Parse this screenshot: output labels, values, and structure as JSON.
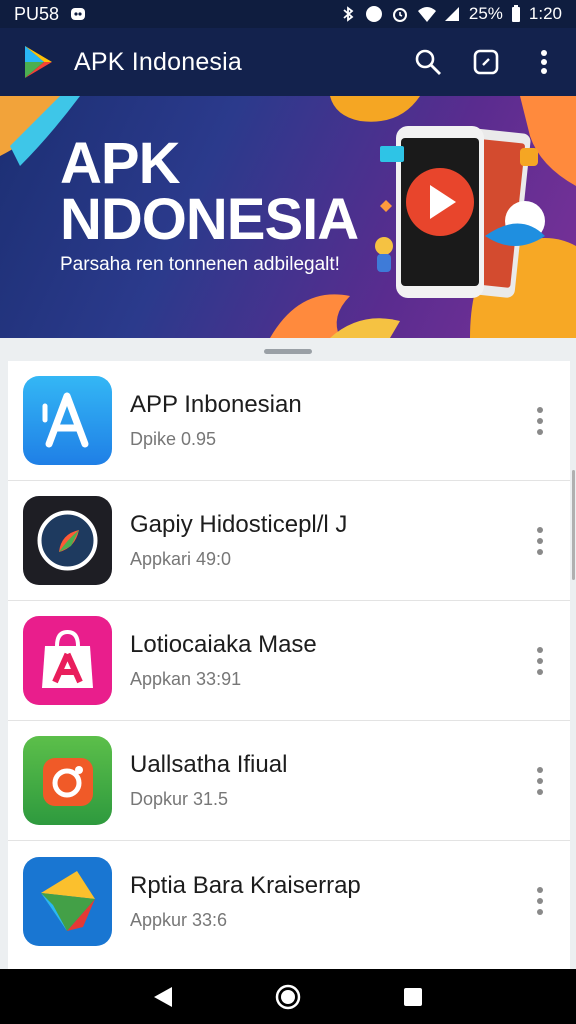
{
  "status_bar": {
    "left_text": "PU58",
    "battery": "25%",
    "time": "1:20"
  },
  "app_bar": {
    "title": "APK Indonesia",
    "icons": [
      "play-logo-icon",
      "search-icon",
      "screen-rotate-icon",
      "overflow-menu-icon"
    ]
  },
  "banner": {
    "headline_line1": "APK",
    "headline_line2": "NDONESIA",
    "tagline": "Parsaha ren tonnenen adbilegalt!"
  },
  "apps": [
    {
      "name": "APP Inbonesian",
      "meta": "Dpike 0.95",
      "icon": "app-store-a-icon",
      "color": "#2196f3"
    },
    {
      "name": "Gapiy Hidosticepl/l J",
      "meta": "Appkari 49:0",
      "icon": "circle-play-icon",
      "color": "#1e1e24"
    },
    {
      "name": "Lotiocaiaka Mase",
      "meta": "Appkan 33:91",
      "icon": "shopping-bag-icon",
      "color": "#e91e8c"
    },
    {
      "name": "Uallsatha Ifiual",
      "meta": "Dopkur 31.5",
      "icon": "camera-app-icon",
      "color": "#43a047"
    },
    {
      "name": "Rptia Bara Kraiserrap",
      "meta": "Appkur 33:6",
      "icon": "play-triangle-icon",
      "color": "#1976d2"
    }
  ],
  "nav_bar": {
    "icons": [
      "back-icon",
      "home-icon",
      "recents-icon"
    ]
  }
}
